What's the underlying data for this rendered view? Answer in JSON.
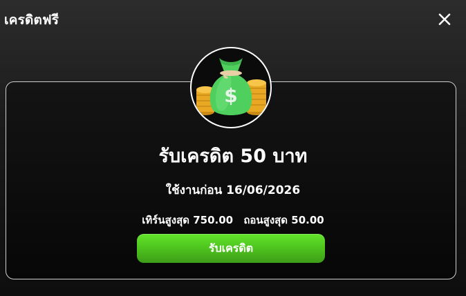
{
  "modal": {
    "title": "เครดิตฟรี",
    "close_icon": "close-icon"
  },
  "offer": {
    "icon": "money-bag-icon",
    "title": "รับเครดิต 50 บาท",
    "expiry": "ใช้งานก่อน 16/06/2026",
    "max_turnover": "เทิร์นสูงสุด 750.00",
    "max_withdraw": "ถอนสูงสุด 50.00",
    "claim_label": "รับเครดิต"
  },
  "colors": {
    "accent_green": "#4cbf1d",
    "background": "#1a1a1a",
    "text": "#ffffff"
  }
}
